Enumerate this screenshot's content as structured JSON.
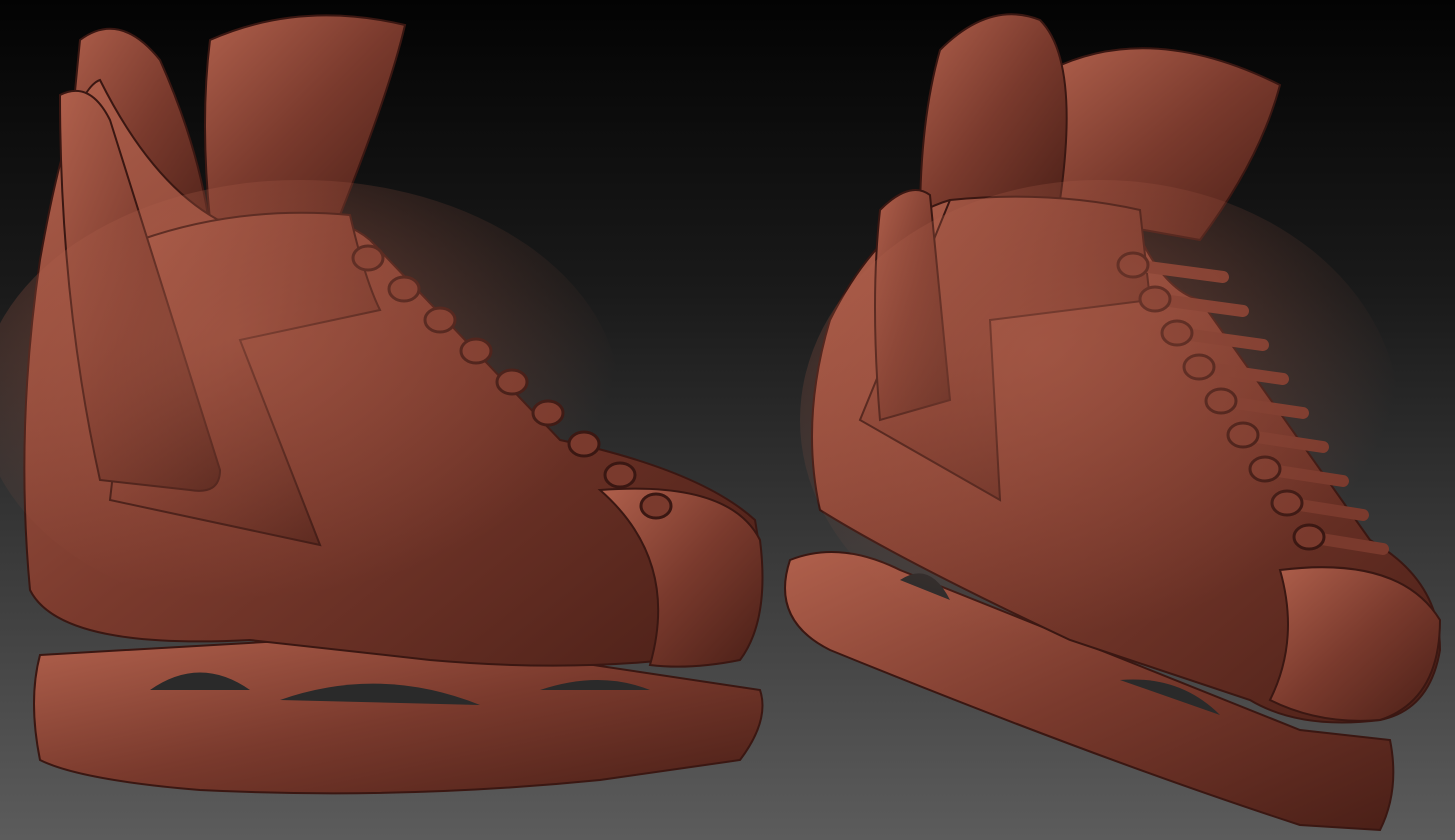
{
  "colors": {
    "background_top": "#030303",
    "background_mid": "#1a1a1a",
    "background_bottom": "#5c5c5c",
    "material_base": "#7a3a2d",
    "material_light": "#b0604c",
    "material_dark": "#4a1f17",
    "material_edge": "#3a1712"
  }
}
